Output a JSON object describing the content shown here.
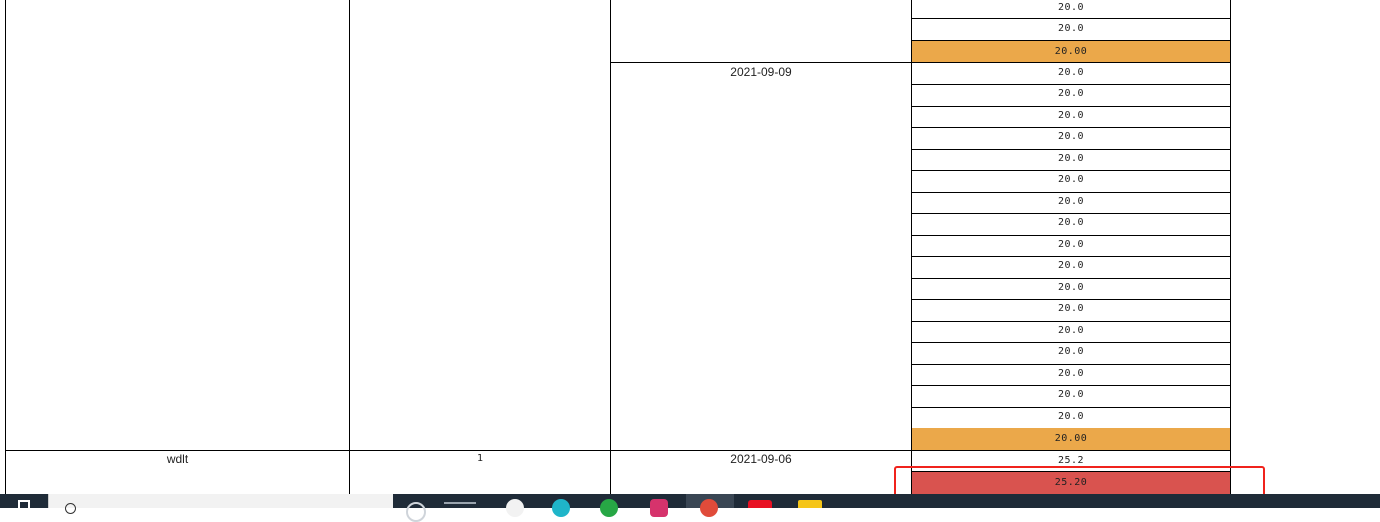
{
  "table": {
    "group_date_1": "2021-09-09",
    "group_values_prev": [
      "20.0",
      "20.0"
    ],
    "group_subtotal_prev": "20.00",
    "group_values_1": [
      "20.0",
      "20.0",
      "20.0",
      "20.0",
      "20.0",
      "20.0",
      "20.0",
      "20.0",
      "20.0",
      "20.0",
      "20.0",
      "20.0",
      "20.0",
      "20.0",
      "20.0",
      "20.0",
      "20.0"
    ],
    "group_subtotal_1": "20.00",
    "row2": {
      "name": "wdlt",
      "count": "1",
      "date": "2021-09-06",
      "value": "25.2",
      "subtotal": "25.20"
    }
  },
  "colors": {
    "subtotal_bg": "#eba84a",
    "highlight_bg": "#d9534f",
    "highlight_border": "#f0231c",
    "taskbar_bg": "#1f2b38"
  },
  "taskbar": {
    "icons": [
      "windows-icon",
      "search-icon",
      "file-explorer-icon",
      "browser-icon",
      "edge-icon",
      "chrome-icon",
      "app-icon",
      "chrome-active-icon",
      "youtube-icon",
      "folder-icon"
    ]
  }
}
